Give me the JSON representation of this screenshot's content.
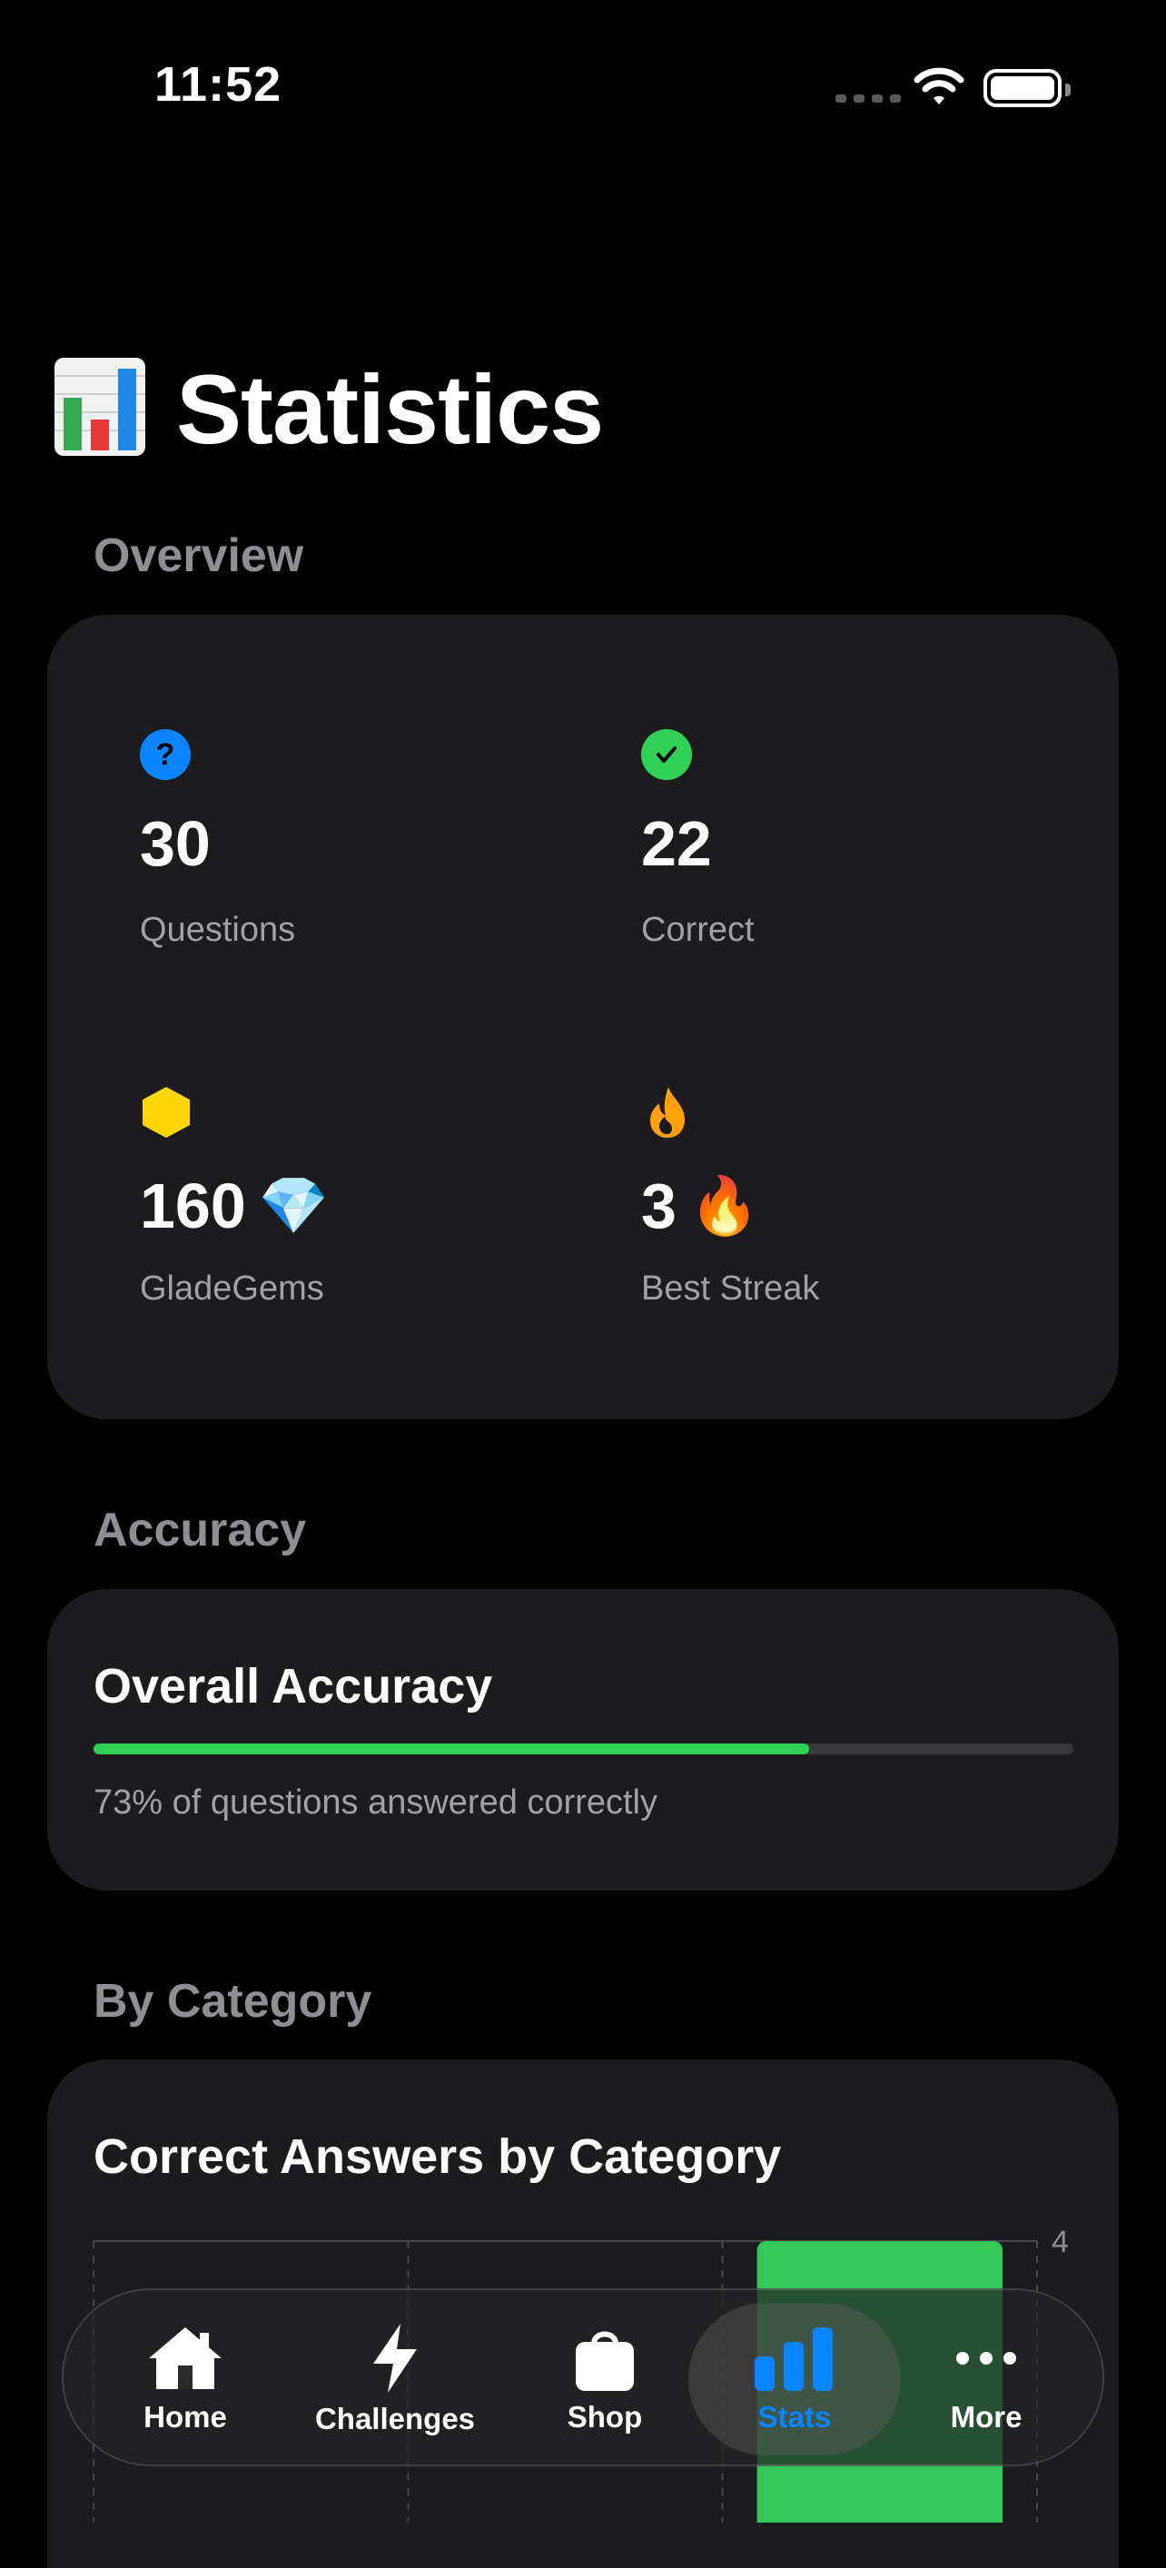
{
  "status_bar": {
    "time": "11:52"
  },
  "header": {
    "title": "Statistics",
    "icon": "bar-chart-emoji-icon"
  },
  "overview": {
    "section_title": "Overview",
    "stats": [
      {
        "value": "30",
        "label": "Questions",
        "icon": "question-circle-icon",
        "icon_color": "#0a84ff",
        "emoji": ""
      },
      {
        "value": "22",
        "label": "Correct",
        "icon": "checkmark-circle-icon",
        "icon_color": "#30d158",
        "emoji": ""
      },
      {
        "value": "160",
        "label": "GladeGems",
        "icon": "hexagon-icon",
        "icon_color": "#ffd60a",
        "emoji": "💎"
      },
      {
        "value": "3",
        "label": "Best Streak",
        "icon": "flame-icon",
        "icon_color": "#ff9f0a",
        "emoji": "🔥"
      }
    ]
  },
  "accuracy": {
    "section_title": "Accuracy",
    "card_title": "Overall Accuracy",
    "percent": 73,
    "caption": "73% of questions answered correctly",
    "bar_color": "#30d158"
  },
  "by_category": {
    "section_title": "By Category",
    "card_title": "Correct Answers by Category"
  },
  "chart_data": {
    "type": "bar",
    "title": "Correct Answers by Category",
    "categories": [
      "",
      "",
      ""
    ],
    "values": [
      null,
      null,
      4
    ],
    "y_tick_labels": [
      "4"
    ],
    "ylim": [
      0,
      4
    ],
    "bar_color": "#34c759",
    "grid": true
  },
  "tabbar": {
    "selected": "Stats",
    "accent": "#0a84ff",
    "tabs": [
      {
        "label": "Home",
        "icon": "house-icon"
      },
      {
        "label": "Challenges",
        "icon": "bolt-icon"
      },
      {
        "label": "Shop",
        "icon": "shopping-bag-icon"
      },
      {
        "label": "Stats",
        "icon": "chart-bar-icon"
      },
      {
        "label": "More",
        "icon": "ellipsis-icon"
      }
    ]
  }
}
